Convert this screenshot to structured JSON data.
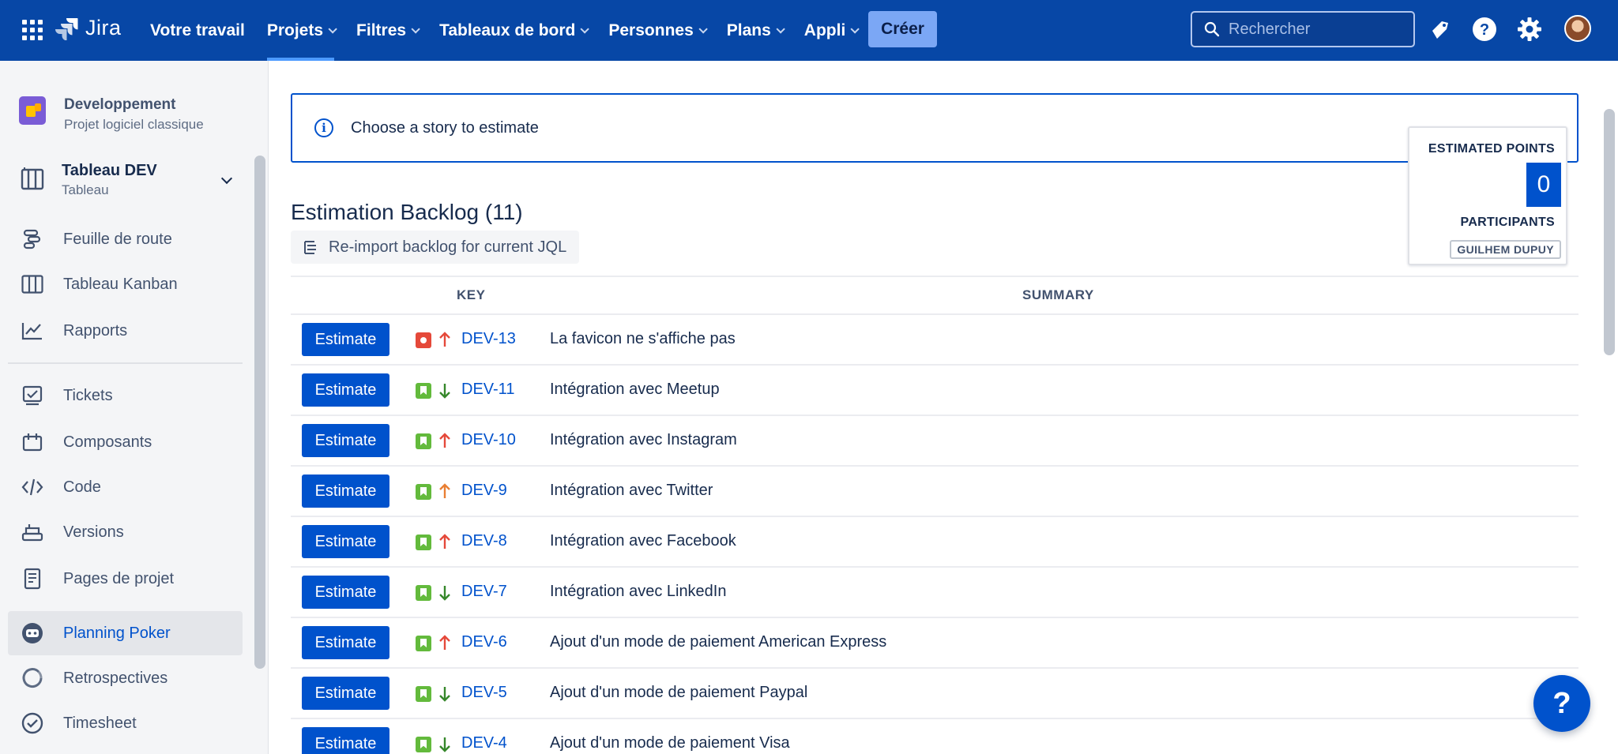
{
  "topnav": {
    "logo_text": "Jira",
    "items": [
      {
        "label": "Votre travail",
        "dropdown": false
      },
      {
        "label": "Projets",
        "dropdown": true,
        "active": true
      },
      {
        "label": "Filtres",
        "dropdown": true
      },
      {
        "label": "Tableaux de bord",
        "dropdown": true
      },
      {
        "label": "Personnes",
        "dropdown": true
      },
      {
        "label": "Plans",
        "dropdown": true
      },
      {
        "label": "Appli",
        "dropdown": true
      }
    ],
    "create_label": "Créer",
    "search_placeholder": "Rechercher",
    "colors": {
      "background": "#0747a6",
      "create_button": "#7ba7f5"
    }
  },
  "sidebar": {
    "project_name": "Developpement",
    "project_type": "Projet logiciel classique",
    "board_name": "Tableau DEV",
    "board_type": "Tableau",
    "items_group1": [
      {
        "label": "Feuille de route",
        "icon": "roadmap-icon"
      },
      {
        "label": "Tableau Kanban",
        "icon": "kanban-icon"
      },
      {
        "label": "Rapports",
        "icon": "reports-icon"
      }
    ],
    "items_group2": [
      {
        "label": "Tickets",
        "icon": "tickets-icon"
      },
      {
        "label": "Composants",
        "icon": "components-icon"
      },
      {
        "label": "Code",
        "icon": "code-icon"
      },
      {
        "label": "Versions",
        "icon": "versions-icon"
      },
      {
        "label": "Pages de projet",
        "icon": "pages-icon"
      },
      {
        "label": "Planning Poker",
        "icon": "planning-poker-icon",
        "active": true
      },
      {
        "label": "Retrospectives",
        "icon": "retrospectives-icon"
      },
      {
        "label": "Timesheet",
        "icon": "timesheet-icon"
      }
    ]
  },
  "main": {
    "info_text": "Choose a story to estimate",
    "estimated_points_label": "ESTIMATED POINTS",
    "estimated_points_value": "0",
    "participants_label": "PARTICIPANTS",
    "participant": "GUILHEM DUPUY",
    "backlog_title": "Estimation Backlog (11)",
    "reimport_label": "Re-import backlog for current JQL",
    "columns": {
      "key": "KEY",
      "summary": "SUMMARY"
    },
    "estimate_label": "Estimate",
    "rows": [
      {
        "key": "DEV-13",
        "summary": "La favicon ne s'affiche pas",
        "type": "bug",
        "priority": "high",
        "priority_color": "#e5493a"
      },
      {
        "key": "DEV-11",
        "summary": "Intégration avec Meetup",
        "type": "story",
        "priority": "low",
        "priority_color": "#36872b"
      },
      {
        "key": "DEV-10",
        "summary": "Intégration avec Instagram",
        "type": "story",
        "priority": "high",
        "priority_color": "#e5493a"
      },
      {
        "key": "DEV-9",
        "summary": "Intégration avec Twitter",
        "type": "story",
        "priority": "medium",
        "priority_color": "#e97f33"
      },
      {
        "key": "DEV-8",
        "summary": "Intégration avec Facebook",
        "type": "story",
        "priority": "high",
        "priority_color": "#e5493a"
      },
      {
        "key": "DEV-7",
        "summary": "Intégration avec LinkedIn",
        "type": "story",
        "priority": "low",
        "priority_color": "#36872b"
      },
      {
        "key": "DEV-6",
        "summary": "Ajout d'un mode de paiement American Express",
        "type": "story",
        "priority": "high",
        "priority_color": "#e5493a"
      },
      {
        "key": "DEV-5",
        "summary": "Ajout d'un mode de paiement Paypal",
        "type": "story",
        "priority": "low",
        "priority_color": "#36872b"
      },
      {
        "key": "DEV-4",
        "summary": "Ajout d'un mode de paiement Visa",
        "type": "story",
        "priority": "low",
        "priority_color": "#36872b"
      }
    ]
  },
  "help_label": "?"
}
